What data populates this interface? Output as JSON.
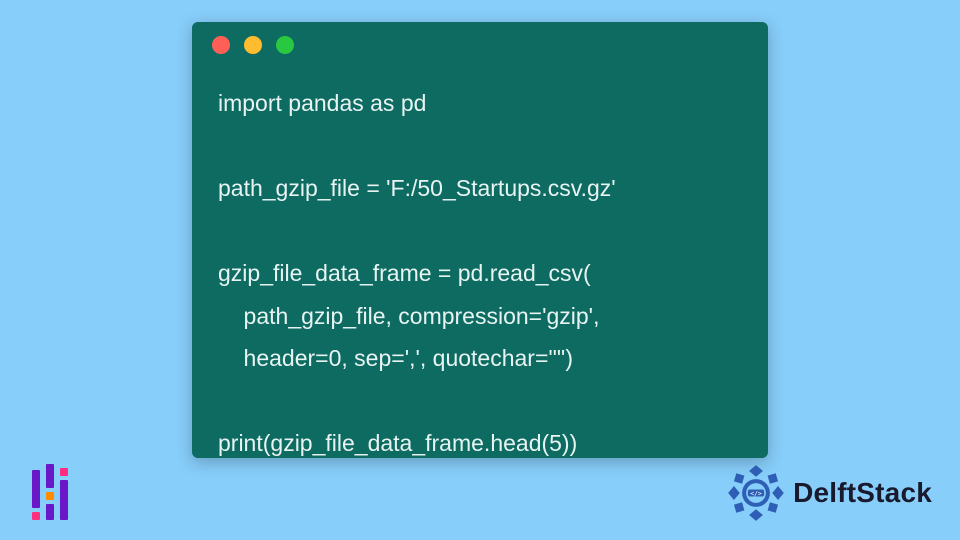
{
  "window": {
    "dots": [
      "red",
      "yellow",
      "green"
    ]
  },
  "code": {
    "lines": [
      "import pandas as pd",
      "",
      "path_gzip_file = 'F:/50_Startups.csv.gz'",
      "",
      "gzip_file_data_frame = pd.read_csv(",
      "    path_gzip_file, compression='gzip',",
      "    header=0, sep=',', quotechar='\"')",
      "",
      "print(gzip_file_data_frame.head(5))"
    ]
  },
  "brand": {
    "name": "DelftStack"
  },
  "colors": {
    "page_bg": "#87cefa",
    "window_bg": "#0e6b62",
    "code_fg": "#e8f4f2",
    "brand_blue": "#2f5fb5",
    "logo_purple": "#6a16c9",
    "logo_orange": "#ff8a00",
    "logo_pink": "#ff2e7e"
  }
}
